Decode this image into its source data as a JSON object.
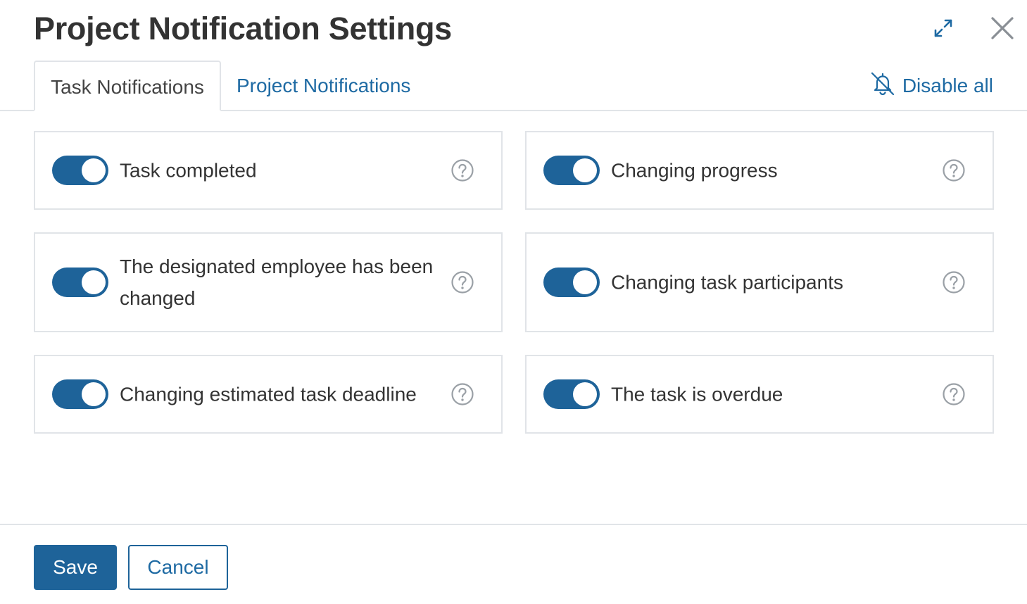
{
  "dialog": {
    "title": "Project Notification Settings",
    "icons": {
      "expand": "expand-icon",
      "close": "close-icon"
    }
  },
  "tabs": [
    {
      "label": "Task Notifications",
      "active": true
    },
    {
      "label": "Project Notifications",
      "active": false
    }
  ],
  "disable_all": {
    "label": "Disable all",
    "icon": "bell-off-icon"
  },
  "settings": [
    {
      "label": "Task completed",
      "enabled": true,
      "help_icon": "help-icon"
    },
    {
      "label": "Changing progress",
      "enabled": true,
      "help_icon": "help-icon"
    },
    {
      "label": "The designated employee has been changed",
      "enabled": true,
      "help_icon": "help-icon"
    },
    {
      "label": "Changing task participants",
      "enabled": true,
      "help_icon": "help-icon"
    },
    {
      "label": "Changing estimated task deadline",
      "enabled": true,
      "help_icon": "help-icon"
    },
    {
      "label": "The task is overdue",
      "enabled": true,
      "help_icon": "help-icon"
    }
  ],
  "footer": {
    "save_label": "Save",
    "cancel_label": "Cancel"
  },
  "colors": {
    "accent": "#1e6399",
    "link": "#1e6aa3",
    "border": "#e1e4e8",
    "text": "#333333"
  }
}
